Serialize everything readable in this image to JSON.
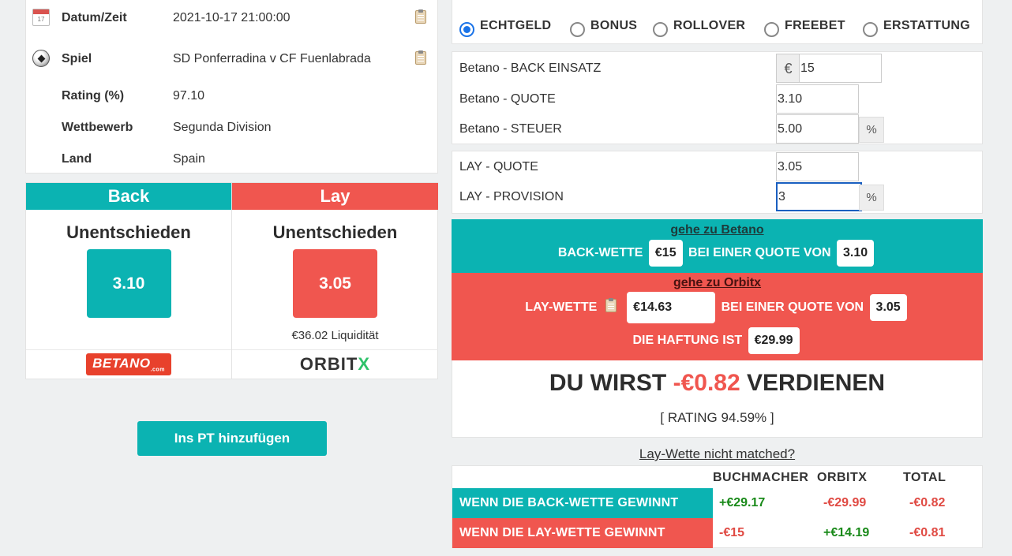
{
  "event": {
    "rows": [
      {
        "label": "Datum/Zeit",
        "value": "2021-10-17 21:00:00"
      },
      {
        "label": "Spiel",
        "value": "SD Ponferradina v CF Fuenlabrada"
      },
      {
        "label": "Rating (%)",
        "value": "97.10"
      },
      {
        "label": "Wettbewerb",
        "value": "Segunda Division"
      },
      {
        "label": "Land",
        "value": "Spain"
      }
    ],
    "calendar_day": "17"
  },
  "odds": {
    "back": {
      "header": "Back",
      "selection": "Unentschieden",
      "price": "3.10",
      "logo": "BETANO",
      "logo_sub": ".com"
    },
    "lay": {
      "header": "Lay",
      "selection": "Unentschieden",
      "price": "3.05",
      "liquidity": "€36.02 Liquidität",
      "logo": "ORBIT",
      "logo_x": "X"
    }
  },
  "add_button": "Ins PT hinzufügen",
  "modes": [
    {
      "label": "ECHTGELD",
      "checked": true
    },
    {
      "label": "BONUS",
      "checked": false
    },
    {
      "label": "ROLLOVER",
      "checked": false
    },
    {
      "label": "FREEBET",
      "checked": false
    },
    {
      "label": "ERSTATTUNG",
      "checked": false
    }
  ],
  "back_form": {
    "stake_label": "Betano - BACK EINSATZ",
    "currency": "€",
    "stake": "15",
    "odds_label": "Betano - QUOTE",
    "odds": "3.10",
    "tax_label": "Betano - STEUER",
    "tax": "5.00",
    "pct": "%"
  },
  "lay_form": {
    "odds_label": "LAY - QUOTE",
    "odds": "3.05",
    "commission_label": "LAY - PROVISION",
    "commission": "3",
    "pct": "%"
  },
  "back_result": {
    "link": "gehe zu Betano",
    "text1": "BACK-WETTE",
    "stake": "€15",
    "text2": "BEI EINER QUOTE VON",
    "odds": "3.10"
  },
  "lay_result": {
    "link": "gehe zu Orbitx",
    "text1": "LAY-WETTE",
    "stake": "€14.63",
    "text2": "BEI EINER QUOTE VON",
    "odds": "3.05",
    "liability_text": "DIE HAFTUNG IST",
    "liability": "€29.99"
  },
  "earnings": {
    "prefix": "DU WIRST",
    "amount": "-€0.82",
    "suffix": "VERDIENEN",
    "rating": "[ RATING 94.59% ]"
  },
  "not_matched_link": "Lay-Wette nicht matched?",
  "summary": {
    "headers": [
      "BUCHMACHER",
      "ORBITX",
      "TOTAL"
    ],
    "rows": [
      {
        "label": "WENN DIE BACK-WETTE GEWINNT",
        "bookmaker": "+€29.17",
        "orbitx": "-€29.99",
        "total": "-€0.82"
      },
      {
        "label": "WENN DIE LAY-WETTE GEWINNT",
        "bookmaker": "-€15",
        "orbitx": "+€14.19",
        "total": "-€0.81"
      }
    ]
  },
  "colors": {
    "teal": "#0bb3b2",
    "red": "#f0564f",
    "positive": "#1a8a1a",
    "negative": "#e04a43",
    "focus": "#1a5fc0"
  }
}
